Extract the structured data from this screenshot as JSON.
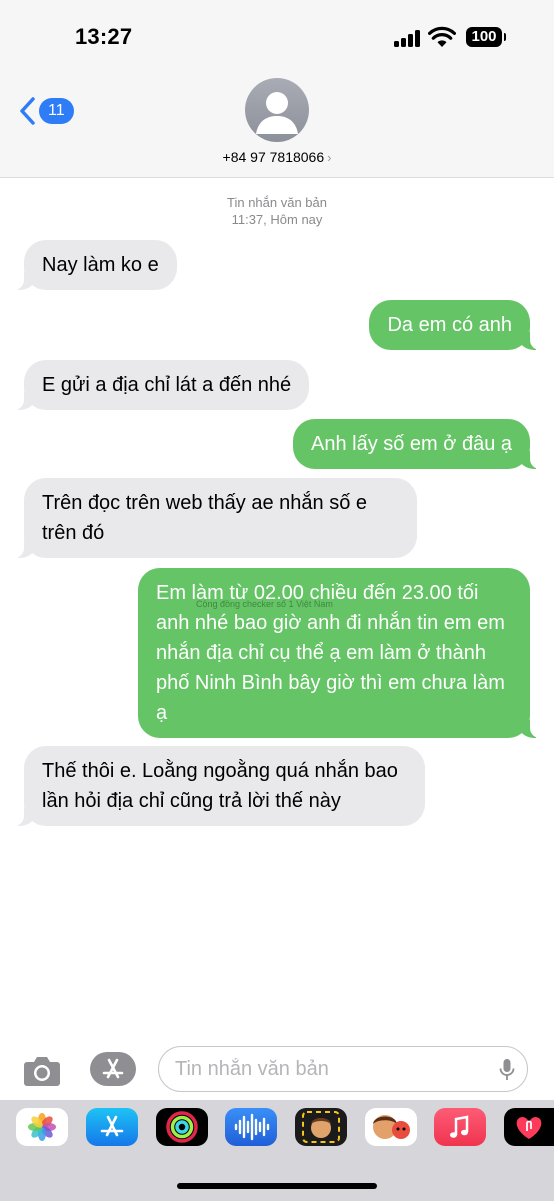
{
  "status_bar": {
    "time": "13:27",
    "battery": "100"
  },
  "header": {
    "back_count": "11",
    "contact": "+84 97 7818066",
    "chevron": "›"
  },
  "thread": {
    "service": "Tin nhắn văn bản",
    "timestamp": "11:37, Hôm nay",
    "messages": [
      {
        "direction": "incoming",
        "text": "Nay làm ko e"
      },
      {
        "direction": "outgoing",
        "text": "Da em có anh"
      },
      {
        "direction": "incoming",
        "text": "E gửi a địa chỉ lát a đến nhé"
      },
      {
        "direction": "outgoing",
        "text": "Anh lấy số em ở đâu ạ"
      },
      {
        "direction": "incoming",
        "text": "Trên đọc trên web thấy ae nhắn số e trên đó"
      },
      {
        "direction": "outgoing",
        "text": "Em làm từ 02.00 chiều đến 23.00 tối anh nhé bao giờ anh đi nhắn tin em em nhắn địa chỉ cụ thể ạ em làm ở thành phố Ninh Bình bây giờ thì em chưa làm ạ",
        "watermark": "Cộng đồng checker số 1 Việt Nam"
      },
      {
        "direction": "incoming",
        "text": "Thế thôi e. Loằng ngoằng quá nhắn bao lần hỏi địa chỉ cũng trả lời thế này"
      }
    ]
  },
  "composer": {
    "placeholder": "Tin nhắn văn bản",
    "value": ""
  },
  "app_drawer": [
    {
      "icon": "photos-icon"
    },
    {
      "icon": "app-store-icon"
    },
    {
      "icon": "fitness-icon"
    },
    {
      "icon": "audio-message-icon"
    },
    {
      "icon": "memoji-icon"
    },
    {
      "icon": "animoji-stickers-icon"
    },
    {
      "icon": "music-icon"
    },
    {
      "icon": "digital-touch-icon"
    }
  ],
  "colors": {
    "outgoing": "#65c466",
    "incoming": "#e9e9eb",
    "accent": "#2f7df6"
  }
}
